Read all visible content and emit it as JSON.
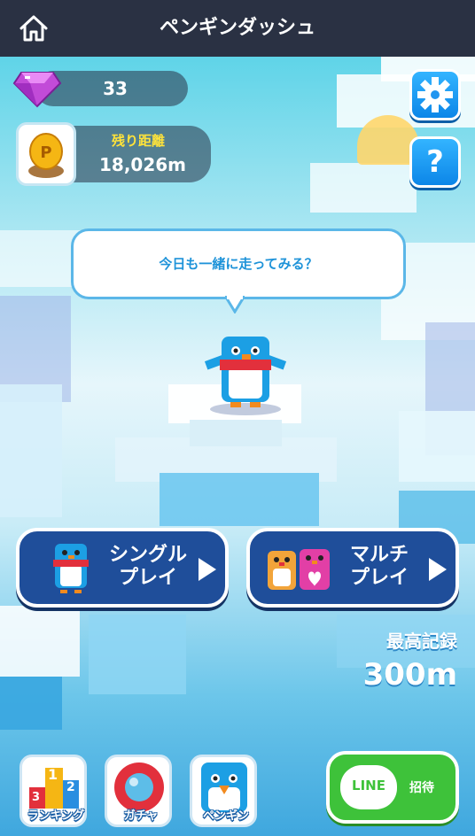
{
  "header": {
    "title": "ペンギンダッシュ",
    "home_icon": "home-icon"
  },
  "currency": {
    "gems": "33",
    "gem_icon": "gem-icon"
  },
  "distance": {
    "label": "残り距離",
    "value": "18,026m",
    "icon": "coin-p-icon"
  },
  "side_buttons": {
    "settings_icon": "gear-icon",
    "help_icon": "question-icon"
  },
  "speech": {
    "text": "今日も一緒に走ってみる？"
  },
  "modes": {
    "single": {
      "label_line1": "シングル",
      "label_line2": "プレイ"
    },
    "multi": {
      "label_line1": "マルチ",
      "label_line2": "プレイ"
    }
  },
  "record": {
    "label": "最高記録",
    "value": "300m"
  },
  "bottom_nav": {
    "ranking": {
      "label": "ランキング",
      "digits": [
        "1",
        "2",
        "3"
      ]
    },
    "gacha": {
      "label": "ガチャ"
    },
    "penguin": {
      "label": "ペンギン"
    },
    "line": {
      "logo": "LINE",
      "label": "招待"
    }
  },
  "colors": {
    "header_bg": "#2a3143",
    "accent_blue": "#1f4e9a",
    "line_green": "#3ec23a",
    "gold": "#ffe33a"
  }
}
